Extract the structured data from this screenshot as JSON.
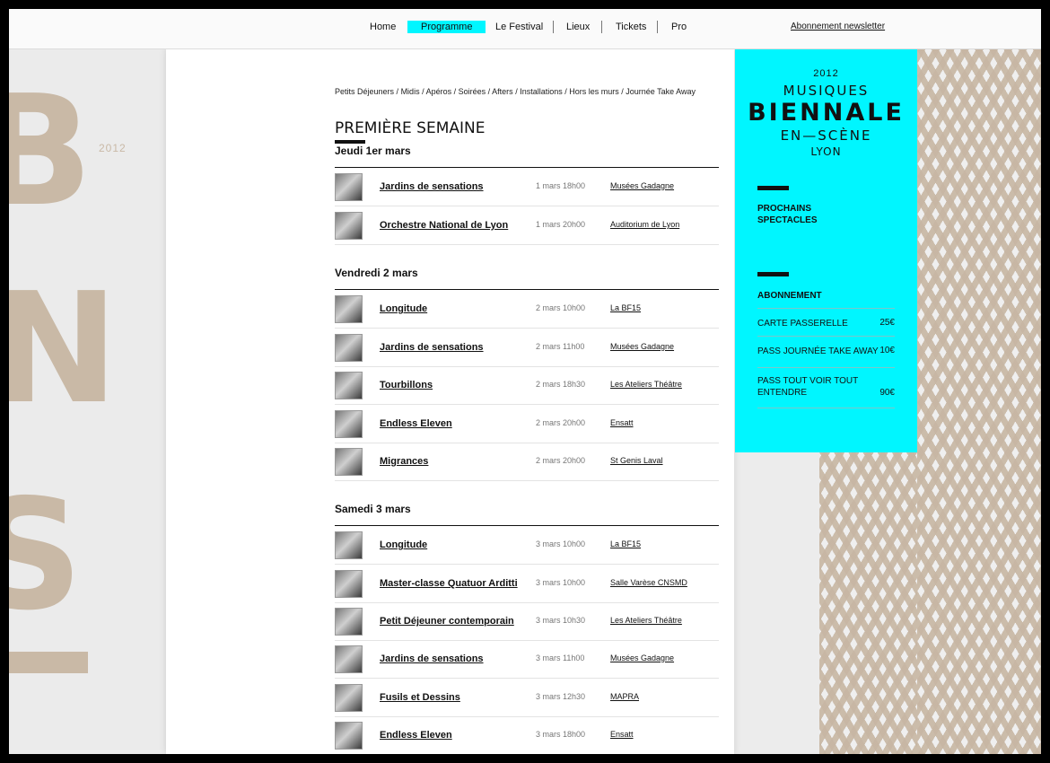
{
  "nav": {
    "items": [
      "Home",
      "Programme",
      "Le Festival",
      "Lieux",
      "Tickets",
      "Pro"
    ],
    "active": "Programme",
    "newsletter": "Abonnement newsletter"
  },
  "decor": {
    "letters": [
      "B",
      "N",
      "S"
    ],
    "year": "2012"
  },
  "breadcrumb": [
    "Petits Déjeuners",
    "Midis",
    "Apéros",
    "Soirées",
    "Afters",
    "Installations",
    "Hors les murs",
    "Journée Take Away"
  ],
  "section_title": "PREMIÈRE SEMAINE",
  "days": [
    {
      "heading": "Jeudi 1er mars",
      "events": [
        {
          "title": "Jardins de sensations",
          "date": "1 mars 18h00",
          "venue": "Musées Gadagne"
        },
        {
          "title": "Orchestre National de Lyon",
          "date": "1 mars 20h00",
          "venue": "Auditorium de Lyon"
        }
      ]
    },
    {
      "heading": "Vendredi 2 mars",
      "events": [
        {
          "title": "Longitude",
          "date": "2 mars 10h00",
          "venue": "La BF15"
        },
        {
          "title": "Jardins de sensations",
          "date": "2 mars 11h00",
          "venue": "Musées Gadagne"
        },
        {
          "title": "Tourbillons",
          "date": "2 mars 18h30",
          "venue": "Les Ateliers Théâtre"
        },
        {
          "title": "Endless Eleven",
          "date": "2 mars 20h00",
          "venue": "Ensatt"
        },
        {
          "title": "Migrances",
          "date": "2 mars 20h00",
          "venue": "St Genis Laval"
        }
      ]
    },
    {
      "heading": "Samedi 3 mars",
      "events": [
        {
          "title": "Longitude",
          "date": "3 mars 10h00",
          "venue": "La BF15"
        },
        {
          "title": "Master-classe Quatuor Arditti",
          "date": "3 mars 10h00",
          "venue": "Salle Varèse CNSMD"
        },
        {
          "title": "Petit Déjeuner contemporain",
          "date": "3 mars 10h30",
          "venue": "Les Ateliers Théâtre"
        },
        {
          "title": "Jardins de sensations",
          "date": "3 mars 11h00",
          "venue": "Musées Gadagne"
        },
        {
          "title": "Fusils et Dessins",
          "date": "3 mars 12h30",
          "venue": "MAPRA"
        },
        {
          "title": "Endless Eleven",
          "date": "3 mars 18h00",
          "venue": "Ensatt"
        }
      ]
    }
  ],
  "sidebar": {
    "logo": {
      "year": "2012",
      "line1": "MUSIQUES",
      "line2": "BIENNALE",
      "line3": "EN—SCÈNE",
      "line4": "LYON"
    },
    "prochains": "PROCHAINS SPECTACLES",
    "abonnement_title": "ABONNEMENT",
    "abonnements": [
      {
        "label": "CARTE PASSERELLE",
        "price": "25€"
      },
      {
        "label": "PASS JOURNÉE TAKE AWAY",
        "price": "10€"
      },
      {
        "label": "PASS TOUT VOIR TOUT ENTENDRE",
        "price": "90€"
      }
    ]
  },
  "colors": {
    "accent": "#00f6ff",
    "decor": "#c9b9a6"
  }
}
